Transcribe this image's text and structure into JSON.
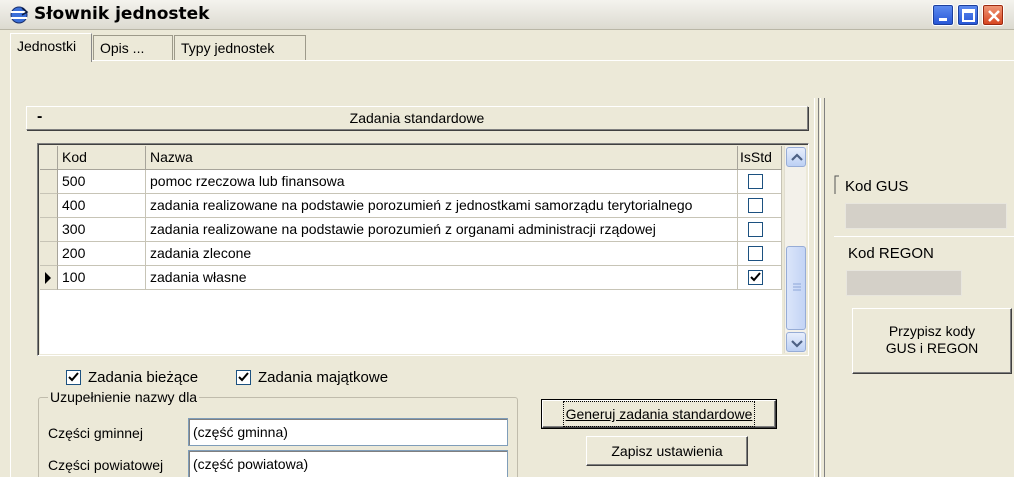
{
  "window": {
    "title": "Słownik jednostek"
  },
  "tabs": [
    {
      "label": "Jednostki",
      "active": true
    },
    {
      "label": "Opis ...",
      "active": false
    },
    {
      "label": "Typy jednostek",
      "active": false
    }
  ],
  "section": {
    "collapse_label": "-",
    "title": "Zadania standardowe"
  },
  "grid": {
    "columns": [
      "Kod",
      "Nazwa",
      "IsStd"
    ],
    "rows": [
      {
        "kod": "500",
        "nazwa": "pomoc rzeczowa lub finansowa",
        "isstd": false,
        "current": false
      },
      {
        "kod": "400",
        "nazwa": "zadania realizowane na podstawie porozumień z jednostkami samorządu terytorialnego",
        "isstd": false,
        "current": false
      },
      {
        "kod": "300",
        "nazwa": "zadania realizowane na podstawie porozumień z organami administracji rządowej",
        "isstd": false,
        "current": false
      },
      {
        "kod": "200",
        "nazwa": "zadania zlecone",
        "isstd": false,
        "current": false
      },
      {
        "kod": "100",
        "nazwa": "zadania własne",
        "isstd": true,
        "current": true
      }
    ]
  },
  "options": {
    "biezace": {
      "label": "Zadania bieżące",
      "checked": true
    },
    "majatkowe": {
      "label": "Zadania majątkowe",
      "checked": true
    }
  },
  "name_fill": {
    "legend": "Uzupełnienie nazwy dla",
    "gminnej_label": "Części gminnej",
    "gminnej_value": "(część gminna)",
    "powiatowej_label": "Części powiatowej",
    "powiatowej_value": "(część powiatowa)"
  },
  "buttons": {
    "generate": "Generuj zadania standardowe",
    "save": "Zapisz ustawienia",
    "assign_line1": "Przypisz kody",
    "assign_line2": "GUS i REGON"
  },
  "right": {
    "kod_gus_label": "Kod GUS",
    "kod_gus_value": "",
    "kod_regon_label": "Kod REGON",
    "kod_regon_value": ""
  },
  "colors": {
    "accent_blue": "#2655d6",
    "close_red": "#d6421c",
    "window_bg": "#ece9d8"
  }
}
